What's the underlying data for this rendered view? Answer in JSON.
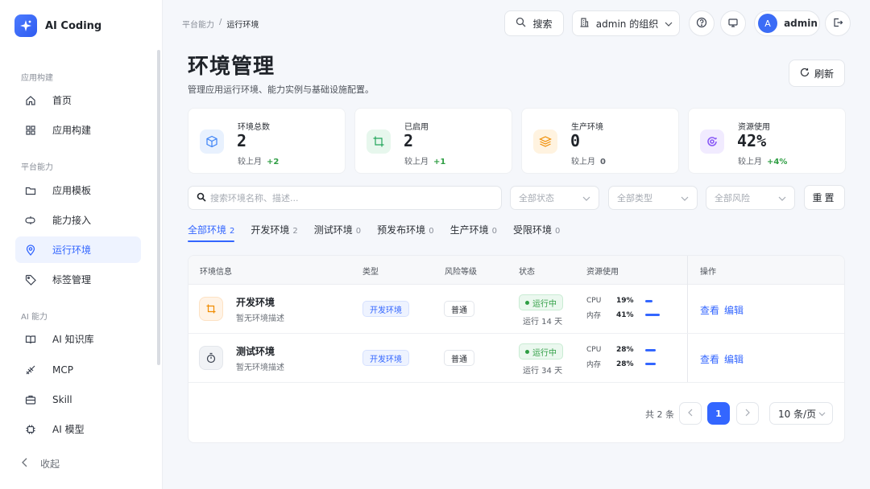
{
  "app": {
    "name": "AI Coding"
  },
  "sidebar": {
    "groups": [
      {
        "label": "应用构建"
      },
      {
        "label": "平台能力"
      },
      {
        "label": "AI 能力"
      }
    ],
    "items": [
      {
        "label": "首页",
        "icon": "home-icon"
      },
      {
        "label": "应用构建",
        "icon": "grid-icon"
      },
      {
        "label": "应用模板",
        "icon": "folder-icon"
      },
      {
        "label": "能力接入",
        "icon": "plug-icon"
      },
      {
        "label": "运行环境",
        "icon": "location-pin-icon",
        "active": true
      },
      {
        "label": "标签管理",
        "icon": "tag-icon"
      },
      {
        "label": "AI 知识库",
        "icon": "book-icon"
      },
      {
        "label": "MCP",
        "icon": "mcp-icon"
      },
      {
        "label": "Skill",
        "icon": "briefcase-icon"
      },
      {
        "label": "AI 模型",
        "icon": "chip-icon"
      }
    ],
    "collapse_label": "收起"
  },
  "breadcrumb": {
    "parent": "平台能力",
    "separator": "/",
    "current": "运行环境"
  },
  "topbar": {
    "search_label": "搜索",
    "org_label": "admin 的组织",
    "avatar_initial": "A",
    "user_name": "admin"
  },
  "page": {
    "title": "环境管理",
    "description": "管理应用运行环境、能力实例与基础设施配置。",
    "refresh_label": "刷新"
  },
  "stats": [
    {
      "label": "环境总数",
      "value": "2",
      "sub_prefix": "较上月",
      "delta": "+2",
      "icon": "cube-icon",
      "color": "#3b82f6",
      "bg": "#e8f1fe"
    },
    {
      "label": "已启用",
      "value": "2",
      "sub_prefix": "较上月",
      "delta": "+1",
      "icon": "crop-icon",
      "color": "#22a55b",
      "bg": "#e7f7ed"
    },
    {
      "label": "生产环境",
      "value": "0",
      "sub_prefix": "较上月",
      "delta": "0",
      "icon": "layers-icon",
      "color": "#f08c00",
      "bg": "#fff3e0"
    },
    {
      "label": "资源使用",
      "value": "42%",
      "sub_prefix": "较上月",
      "delta": "+4%",
      "icon": "grafana-icon",
      "color": "#8b5cf6",
      "bg": "#f1ebff"
    }
  ],
  "filters": {
    "search_placeholder": "搜索环境名称、描述...",
    "status_label": "全部状态",
    "type_label": "全部类型",
    "risk_label": "全部风险",
    "reset_label": "重置"
  },
  "tabs": [
    {
      "label": "全部环境",
      "count": "2",
      "active": true
    },
    {
      "label": "开发环境",
      "count": "2"
    },
    {
      "label": "测试环境",
      "count": "0"
    },
    {
      "label": "预发布环境",
      "count": "0"
    },
    {
      "label": "生产环境",
      "count": "0"
    },
    {
      "label": "受限环境",
      "count": "0"
    }
  ],
  "table": {
    "headers": {
      "info": "环境信息",
      "type": "类型",
      "risk": "风险等级",
      "status": "状态",
      "resource": "资源使用",
      "action": "操作"
    },
    "rows": [
      {
        "name": "开发环境",
        "desc": "暂无环境描述",
        "icon": "crop-icon",
        "icon_color": "#f08c00",
        "icon_bg": "#fff3e6",
        "type": "开发环境",
        "risk": "普通",
        "status": "运行中",
        "uptime": "运行 14 天",
        "cpu_label": "CPU",
        "cpu": "19%",
        "cpu_value": 19,
        "mem_label": "内存",
        "mem": "41%",
        "mem_value": 41,
        "view_label": "查看",
        "edit_label": "编辑"
      },
      {
        "name": "测试环境",
        "desc": "暂无环境描述",
        "icon": "timer-icon",
        "icon_color": "#3b4250",
        "icon_bg": "#f1f3f6",
        "type": "开发环境",
        "risk": "普通",
        "status": "运行中",
        "uptime": "运行 34 天",
        "cpu_label": "CPU",
        "cpu": "28%",
        "cpu_value": 28,
        "mem_label": "内存",
        "mem": "28%",
        "mem_value": 28,
        "view_label": "查看",
        "edit_label": "编辑"
      }
    ]
  },
  "pagination": {
    "total_text": "共 2 条",
    "current_page": "1",
    "page_size": "10 条/页"
  },
  "colors": {
    "accent": "#3366ff",
    "success": "#2f9e44"
  }
}
